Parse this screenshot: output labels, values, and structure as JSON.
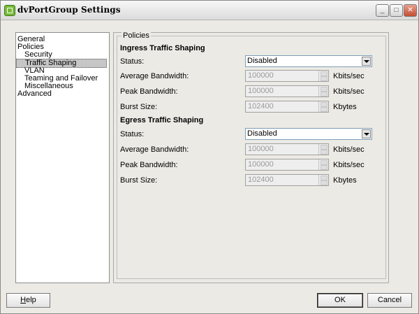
{
  "window": {
    "title": "dvPortGroup Settings",
    "minimize": "_",
    "maximize": "□",
    "close": "✕"
  },
  "nav": {
    "items": [
      {
        "label": "General"
      },
      {
        "label": "Policies"
      },
      {
        "label": "Security"
      },
      {
        "label": "Traffic Shaping",
        "selected": true
      },
      {
        "label": "VLAN"
      },
      {
        "label": "Teaming and Failover"
      },
      {
        "label": "Miscellaneous"
      },
      {
        "label": "Advanced"
      }
    ]
  },
  "policies": {
    "legend": "Policies",
    "ingress": {
      "title": "Ingress Traffic Shaping",
      "status_label": "Status:",
      "status_value": "Disabled",
      "avg_label": "Average Bandwidth:",
      "avg_value": "100000",
      "avg_unit": "Kbits/sec",
      "peak_label": "Peak Bandwidth:",
      "peak_value": "100000",
      "peak_unit": "Kbits/sec",
      "burst_label": "Burst Size:",
      "burst_value": "102400",
      "burst_unit": "Kbytes"
    },
    "egress": {
      "title": "Egress Traffic Shaping",
      "status_label": "Status:",
      "status_value": "Disabled",
      "avg_label": "Average Bandwidth:",
      "avg_value": "100000",
      "avg_unit": "Kbits/sec",
      "peak_label": "Peak Bandwidth:",
      "peak_value": "100000",
      "peak_unit": "Kbits/sec",
      "burst_label": "Burst Size:",
      "burst_value": "102400",
      "burst_unit": "Kbytes"
    }
  },
  "buttons": {
    "help_mnemonic": "H",
    "help_rest": "elp",
    "ok": "OK",
    "cancel": "Cancel"
  }
}
